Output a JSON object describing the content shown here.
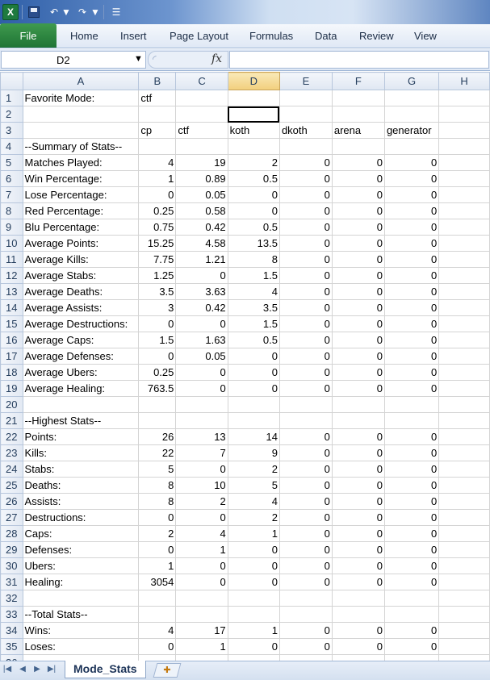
{
  "ribbon": {
    "file_tab": "File",
    "tabs": [
      "Home",
      "Insert",
      "Page Layout",
      "Formulas",
      "Data",
      "Review",
      "View"
    ]
  },
  "quick_access": {
    "app_icon": "excel-icon",
    "icons": [
      "save-icon",
      "undo-icon",
      "redo-icon",
      "customize-icon"
    ]
  },
  "formula_bar": {
    "name_box": "D2",
    "fx_label": "fx",
    "formula": ""
  },
  "grid": {
    "columns": [
      "A",
      "B",
      "C",
      "D",
      "E",
      "F",
      "G",
      "H"
    ],
    "active_cell": "D2",
    "rows": [
      {
        "n": "1",
        "cells": [
          "Favorite Mode:",
          "ctf",
          "",
          "",
          "",
          "",
          "",
          ""
        ]
      },
      {
        "n": "2",
        "cells": [
          "",
          "",
          "",
          "",
          "",
          "",
          "",
          ""
        ]
      },
      {
        "n": "3",
        "cells": [
          "",
          "cp",
          "ctf",
          "koth",
          "dkoth",
          "arena",
          "generator",
          ""
        ]
      },
      {
        "n": "4",
        "cells": [
          "--Summary of Stats--",
          "",
          "",
          "",
          "",
          "",
          "",
          ""
        ]
      },
      {
        "n": "5",
        "cells": [
          "Matches Played:",
          "4",
          "19",
          "2",
          "0",
          "0",
          "0",
          ""
        ]
      },
      {
        "n": "6",
        "cells": [
          "Win Percentage:",
          "1",
          "0.89",
          "0.5",
          "0",
          "0",
          "0",
          ""
        ]
      },
      {
        "n": "7",
        "cells": [
          "Lose Percentage:",
          "0",
          "0.05",
          "0",
          "0",
          "0",
          "0",
          ""
        ]
      },
      {
        "n": "8",
        "cells": [
          "Red Percentage:",
          "0.25",
          "0.58",
          "0",
          "0",
          "0",
          "0",
          ""
        ]
      },
      {
        "n": "9",
        "cells": [
          "Blu Percentage:",
          "0.75",
          "0.42",
          "0.5",
          "0",
          "0",
          "0",
          ""
        ]
      },
      {
        "n": "10",
        "cells": [
          "Average Points:",
          "15.25",
          "4.58",
          "13.5",
          "0",
          "0",
          "0",
          ""
        ]
      },
      {
        "n": "11",
        "cells": [
          "Average Kills:",
          "7.75",
          "1.21",
          "8",
          "0",
          "0",
          "0",
          ""
        ]
      },
      {
        "n": "12",
        "cells": [
          "Average Stabs:",
          "1.25",
          "0",
          "1.5",
          "0",
          "0",
          "0",
          ""
        ]
      },
      {
        "n": "13",
        "cells": [
          "Average Deaths:",
          "3.5",
          "3.63",
          "4",
          "0",
          "0",
          "0",
          ""
        ]
      },
      {
        "n": "14",
        "cells": [
          "Average Assists:",
          "3",
          "0.42",
          "3.5",
          "0",
          "0",
          "0",
          ""
        ]
      },
      {
        "n": "15",
        "cells": [
          "Average Destructions:",
          "0",
          "0",
          "1.5",
          "0",
          "0",
          "0",
          ""
        ]
      },
      {
        "n": "16",
        "cells": [
          "Average Caps:",
          "1.5",
          "1.63",
          "0.5",
          "0",
          "0",
          "0",
          ""
        ]
      },
      {
        "n": "17",
        "cells": [
          "Average Defenses:",
          "0",
          "0.05",
          "0",
          "0",
          "0",
          "0",
          ""
        ]
      },
      {
        "n": "18",
        "cells": [
          "Average Ubers:",
          "0.25",
          "0",
          "0",
          "0",
          "0",
          "0",
          ""
        ]
      },
      {
        "n": "19",
        "cells": [
          "Average Healing:",
          "763.5",
          "0",
          "0",
          "0",
          "0",
          "0",
          ""
        ]
      },
      {
        "n": "20",
        "cells": [
          "",
          "",
          "",
          "",
          "",
          "",
          "",
          ""
        ]
      },
      {
        "n": "21",
        "cells": [
          "--Highest Stats--",
          "",
          "",
          "",
          "",
          "",
          "",
          ""
        ]
      },
      {
        "n": "22",
        "cells": [
          "Points:",
          "26",
          "13",
          "14",
          "0",
          "0",
          "0",
          ""
        ]
      },
      {
        "n": "23",
        "cells": [
          "Kills:",
          "22",
          "7",
          "9",
          "0",
          "0",
          "0",
          ""
        ]
      },
      {
        "n": "24",
        "cells": [
          "Stabs:",
          "5",
          "0",
          "2",
          "0",
          "0",
          "0",
          ""
        ]
      },
      {
        "n": "25",
        "cells": [
          "Deaths:",
          "8",
          "10",
          "5",
          "0",
          "0",
          "0",
          ""
        ]
      },
      {
        "n": "26",
        "cells": [
          "Assists:",
          "8",
          "2",
          "4",
          "0",
          "0",
          "0",
          ""
        ]
      },
      {
        "n": "27",
        "cells": [
          "Destructions:",
          "0",
          "0",
          "2",
          "0",
          "0",
          "0",
          ""
        ]
      },
      {
        "n": "28",
        "cells": [
          "Caps:",
          "2",
          "4",
          "1",
          "0",
          "0",
          "0",
          ""
        ]
      },
      {
        "n": "29",
        "cells": [
          "Defenses:",
          "0",
          "1",
          "0",
          "0",
          "0",
          "0",
          ""
        ]
      },
      {
        "n": "30",
        "cells": [
          "Ubers:",
          "1",
          "0",
          "0",
          "0",
          "0",
          "0",
          ""
        ]
      },
      {
        "n": "31",
        "cells": [
          "Healing:",
          "3054",
          "0",
          "0",
          "0",
          "0",
          "0",
          ""
        ]
      },
      {
        "n": "32",
        "cells": [
          "",
          "",
          "",
          "",
          "",
          "",
          "",
          ""
        ]
      },
      {
        "n": "33",
        "cells": [
          "--Total Stats--",
          "",
          "",
          "",
          "",
          "",
          "",
          ""
        ]
      },
      {
        "n": "34",
        "cells": [
          "Wins:",
          "4",
          "17",
          "1",
          "0",
          "0",
          "0",
          ""
        ]
      },
      {
        "n": "35",
        "cells": [
          "Loses:",
          "0",
          "1",
          "0",
          "0",
          "0",
          "0",
          ""
        ]
      },
      {
        "n": "36",
        "cells": [
          "",
          "",
          "",
          "",
          "",
          "",
          "",
          ""
        ]
      }
    ]
  },
  "sheet_tabs": {
    "active": "Mode_Stats",
    "nav": [
      "first-sheet-icon",
      "prev-sheet-icon",
      "next-sheet-icon",
      "last-sheet-icon"
    ],
    "insert_icon": "insert-sheet-icon"
  },
  "colors": {
    "file_tab": "#2a8540",
    "header_selected": "#f2cf7d",
    "ribbon": "#dfe8f5"
  }
}
